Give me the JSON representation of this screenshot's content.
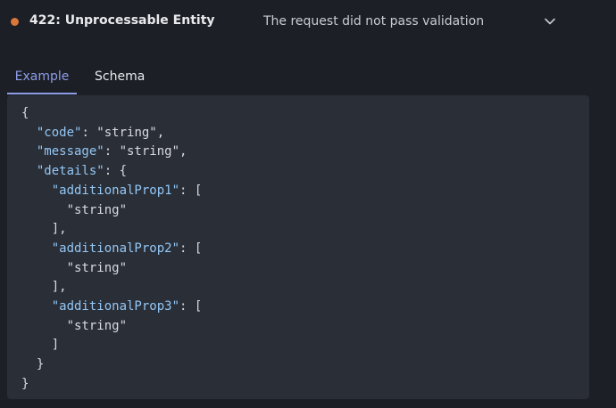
{
  "response": {
    "status_title": "422: Unprocessable Entity",
    "description": "The request did not pass validation",
    "status_color": "#d9773a",
    "expand_icon": "chevron-down-icon"
  },
  "tabs": [
    {
      "label": "Example",
      "active": true
    },
    {
      "label": "Schema",
      "active": false
    }
  ],
  "example": {
    "lines": [
      [
        {
          "t": "p",
          "v": "{"
        }
      ],
      [
        {
          "t": "p",
          "v": "  "
        },
        {
          "t": "k",
          "v": "\"code\""
        },
        {
          "t": "p",
          "v": ": "
        },
        {
          "t": "s",
          "v": "\"string\""
        },
        {
          "t": "p",
          "v": ","
        }
      ],
      [
        {
          "t": "p",
          "v": "  "
        },
        {
          "t": "k",
          "v": "\"message\""
        },
        {
          "t": "p",
          "v": ": "
        },
        {
          "t": "s",
          "v": "\"string\""
        },
        {
          "t": "p",
          "v": ","
        }
      ],
      [
        {
          "t": "p",
          "v": "  "
        },
        {
          "t": "k",
          "v": "\"details\""
        },
        {
          "t": "p",
          "v": ": {"
        }
      ],
      [
        {
          "t": "p",
          "v": "    "
        },
        {
          "t": "k",
          "v": "\"additionalProp1\""
        },
        {
          "t": "p",
          "v": ": ["
        }
      ],
      [
        {
          "t": "p",
          "v": "      "
        },
        {
          "t": "s",
          "v": "\"string\""
        }
      ],
      [
        {
          "t": "p",
          "v": "    ],"
        }
      ],
      [
        {
          "t": "p",
          "v": "    "
        },
        {
          "t": "k",
          "v": "\"additionalProp2\""
        },
        {
          "t": "p",
          "v": ": ["
        }
      ],
      [
        {
          "t": "p",
          "v": "      "
        },
        {
          "t": "s",
          "v": "\"string\""
        }
      ],
      [
        {
          "t": "p",
          "v": "    ],"
        }
      ],
      [
        {
          "t": "p",
          "v": "    "
        },
        {
          "t": "k",
          "v": "\"additionalProp3\""
        },
        {
          "t": "p",
          "v": ": ["
        }
      ],
      [
        {
          "t": "p",
          "v": "      "
        },
        {
          "t": "s",
          "v": "\"string\""
        }
      ],
      [
        {
          "t": "p",
          "v": "    ]"
        }
      ],
      [
        {
          "t": "p",
          "v": "  }"
        }
      ],
      [
        {
          "t": "p",
          "v": "}"
        }
      ]
    ]
  }
}
